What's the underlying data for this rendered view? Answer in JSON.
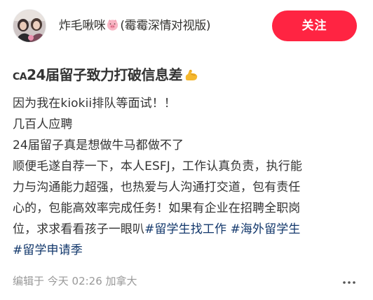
{
  "author": {
    "name_prefix": "炸毛啾咪",
    "name_suffix": "(霉霉深情对视版)",
    "avatar_icon": "user-avatar-photo",
    "badge_icon": "pig-face-icon"
  },
  "follow_button": {
    "label": "关注",
    "color": "#ff2442"
  },
  "post": {
    "title_prefix": "CA",
    "title_text": "24届留子致力打破信息差",
    "title_emoji_icon": "flexed-biceps-icon",
    "lines": [
      "因为我在kiokii排队等面试！！",
      "几百人应聘",
      "24届留子真是想做牛马都做不了",
      "顺便毛遂自荐一下，本人ESFJ，工作认真负责，执行能",
      "力与沟通能力超强，也热爱与人沟通打交道，包有责任",
      "心的，包能高效率完成任务！如果有企业在招聘全职岗"
    ],
    "line7_text": "位，求求看看孩子一眼叭",
    "hashtags": [
      "#留学生找工作",
      "#海外留学生",
      "#留学申请季"
    ],
    "hashtag_color": "#13386c"
  },
  "footer": {
    "meta": "编辑于 今天 02:26 加拿大",
    "more_icon": "more-dots-icon"
  }
}
